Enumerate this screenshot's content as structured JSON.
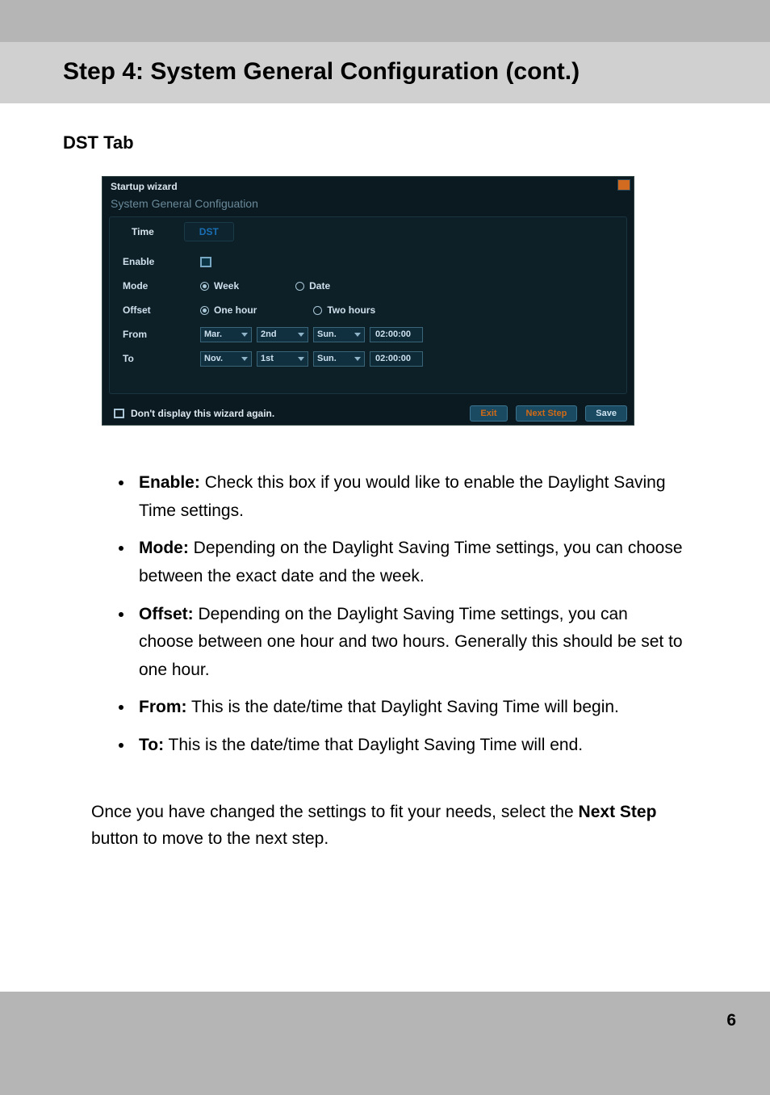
{
  "page": {
    "title": "Step 4: System General Configuration (cont.)",
    "section": "DST Tab",
    "number": "6"
  },
  "screenshot": {
    "window_title": "Startup wizard",
    "subtitle": "System General Configuation",
    "tabs": {
      "time": "Time",
      "dst": "DST"
    },
    "labels": {
      "enable": "Enable",
      "mode": "Mode",
      "offset": "Offset",
      "from": "From",
      "to": "To"
    },
    "mode": {
      "week": "Week",
      "date": "Date"
    },
    "offset": {
      "one_hour": "One hour",
      "two_hours": "Two hours"
    },
    "from": {
      "month": "Mar.",
      "ord": "2nd",
      "day": "Sun.",
      "time": "02:00:00"
    },
    "to": {
      "month": "Nov.",
      "ord": "1st",
      "day": "Sun.",
      "time": "02:00:00"
    },
    "footer": {
      "dont_show": "Don't display this wizard again.",
      "exit": "Exit",
      "next": "Next Step",
      "save": "Save"
    }
  },
  "bullets": {
    "enable": {
      "label": "Enable:",
      "text": " Check this box if you would like to enable the Daylight Saving Time settings."
    },
    "mode": {
      "label": "Mode:",
      "text": " Depending on the Daylight Saving Time settings, you can choose between the exact date and the week."
    },
    "offset": {
      "label": "Offset:",
      "text": " Depending on the Daylight Saving Time settings, you can choose between one hour and two hours. Generally this should be set to one hour."
    },
    "from": {
      "label": "From:",
      "text": " This is the date/time that Daylight Saving Time will begin."
    },
    "to": {
      "label": "To:",
      "text": " This is the date/time that Daylight Saving Time will end."
    }
  },
  "closing": {
    "part1": "Once you have changed the settings to fit your needs, select the ",
    "bold1": "Next Step",
    "part2": " button to move to the next step."
  }
}
